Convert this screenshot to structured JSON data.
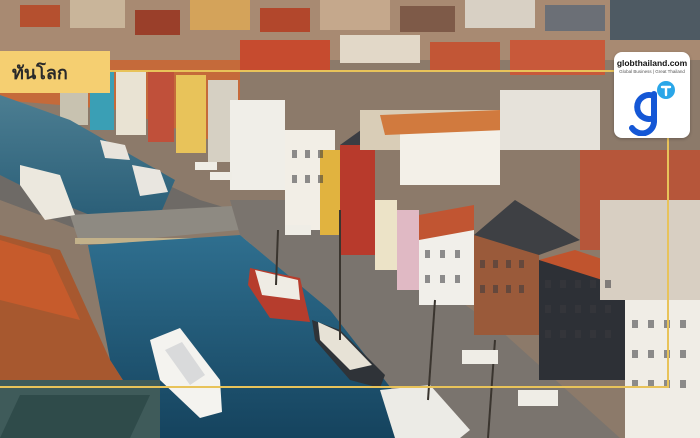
{
  "category_tag": "ทันโลก",
  "logo": {
    "site": "globthailand.com",
    "tagline": "Global Business | Great Thailand",
    "brand_color": "#1457d6",
    "accent_color": "#2aa6e8"
  },
  "colors": {
    "tag_background": "#f5cf71",
    "frame_line": "#e8c35a",
    "water": "#1f5f82"
  }
}
